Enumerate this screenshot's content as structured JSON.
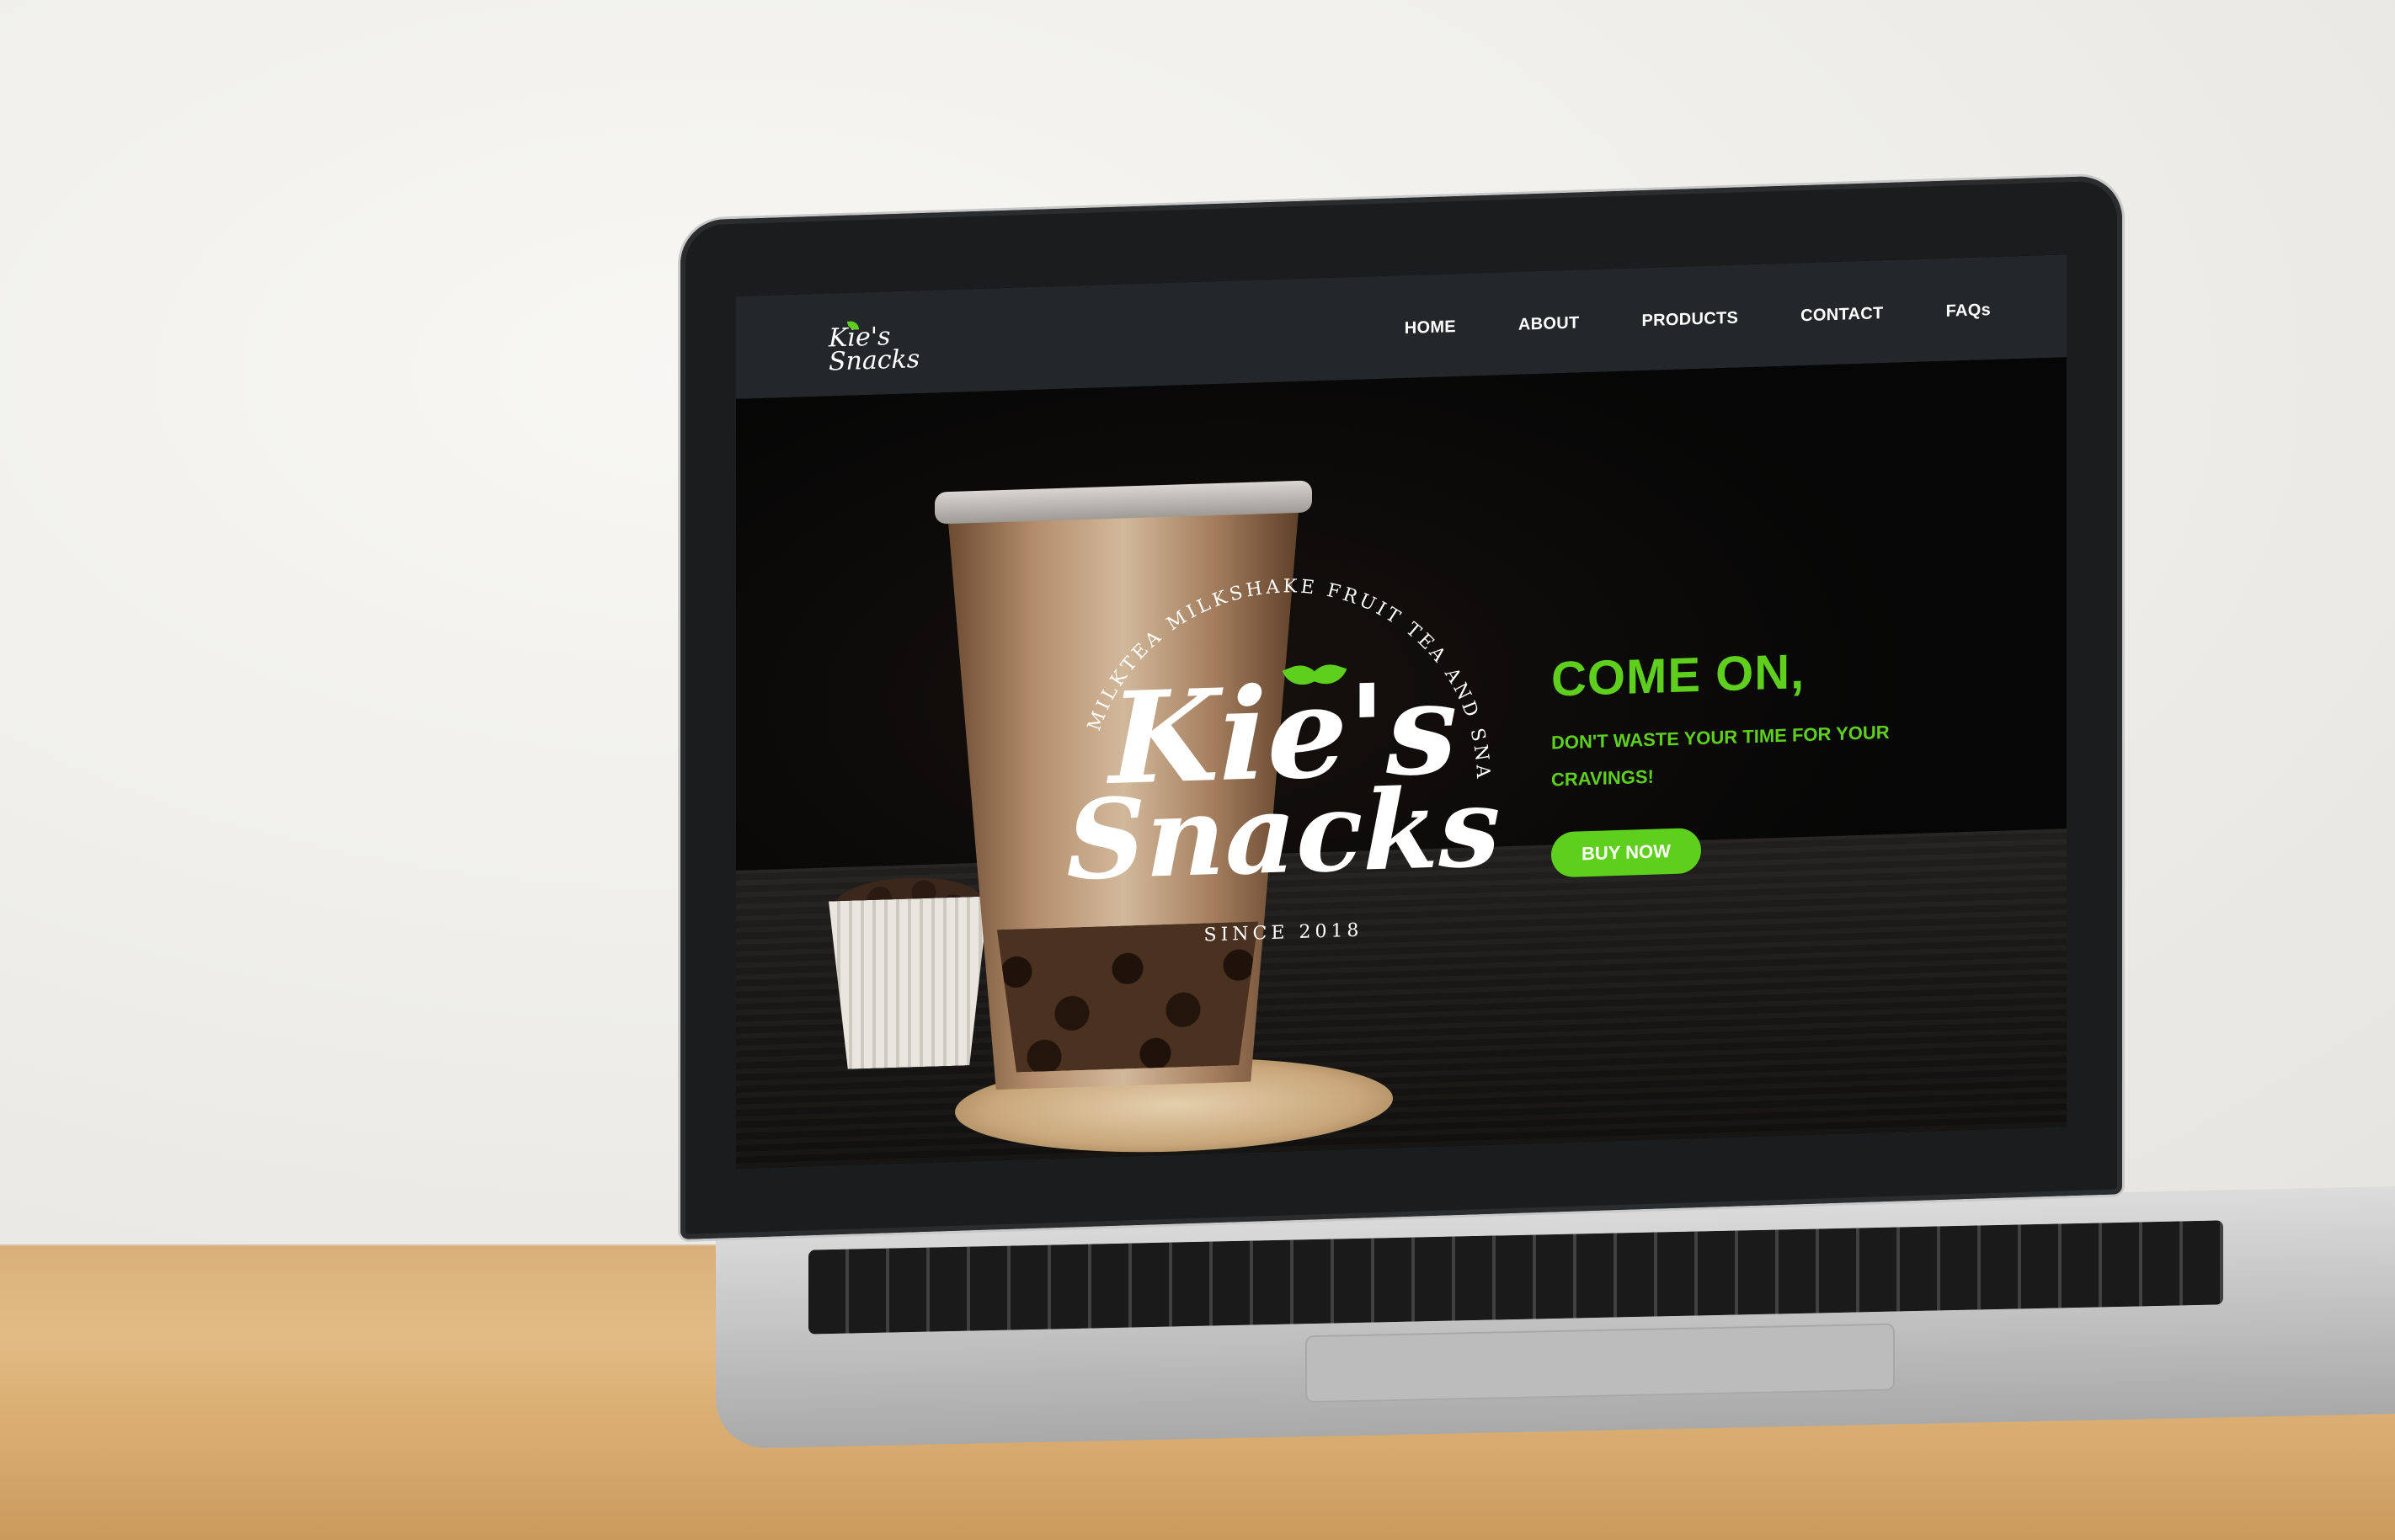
{
  "site": {
    "logo_small_line1": "Kie's",
    "logo_small_line2": "Snacks",
    "nav": [
      "HOME",
      "ABOUT",
      "PRODUCTS",
      "CONTACT",
      "FAQs"
    ]
  },
  "hero": {
    "brand_ring_text": "MILKTEA MILKSHAKE FRUIT TEA AND SNACKS",
    "brand_line1": "Kie's",
    "brand_line2": "Snacks",
    "brand_since": "SINCE 2018",
    "title": "COME ON,",
    "subtitle": "DON'T WASTE YOUR TIME FOR YOUR CRAVINGS!",
    "button_label": "BUY NOW"
  },
  "colors": {
    "accent": "#5fcf1d",
    "navbar": "#23272a",
    "hero_bg": "#060606"
  },
  "icons": {
    "leaf": "leaf-icon"
  }
}
